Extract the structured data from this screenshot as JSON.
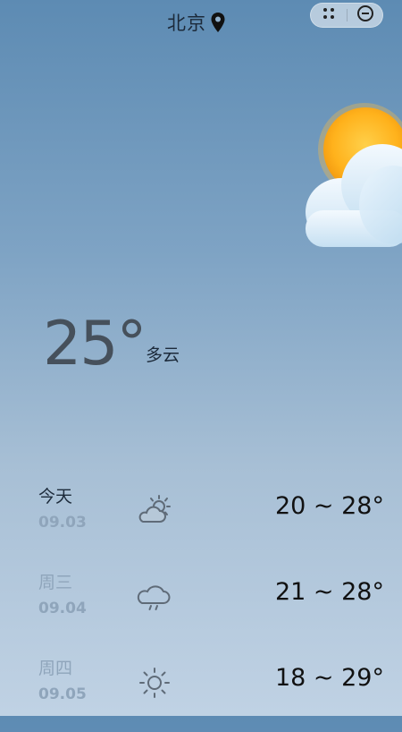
{
  "header": {
    "city": "北京",
    "location_icon": "location-pin-icon",
    "capsule": {
      "more_icon": "more-dots-icon",
      "close_icon": "close-minus-icon"
    }
  },
  "current": {
    "temperature": "25°",
    "condition": "多云",
    "hero_icon": "sun-behind-cloud-icon"
  },
  "forecast": [
    {
      "day": "今天",
      "date": "09.03",
      "icon": "partly-cloudy-icon",
      "range": "20 ~ 28°",
      "day_color": "#1c2a3a"
    },
    {
      "day": "周三",
      "date": "09.04",
      "icon": "cloud-rain-icon",
      "range": "21 ~ 28°",
      "day_color": "#8fa5bb"
    },
    {
      "day": "周四",
      "date": "09.05",
      "icon": "sun-icon",
      "range": "18 ~ 29°",
      "day_color": "#8fa5bb"
    }
  ],
  "colors": {
    "background_top": "#5d8bb3",
    "background_bottom": "#c0d2e4",
    "sun": "#ffb020",
    "cloud": "#e8f3fb"
  }
}
